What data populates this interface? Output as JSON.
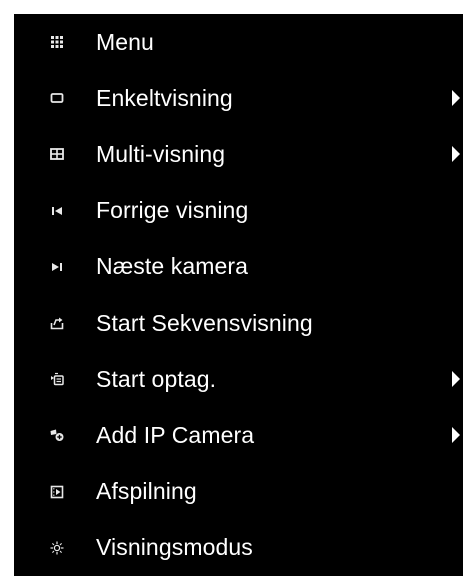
{
  "menu": {
    "items": [
      {
        "label": "Menu",
        "icon": "grid-icon",
        "has_submenu": false
      },
      {
        "label": "Enkeltvisning",
        "icon": "single-view-icon",
        "has_submenu": true
      },
      {
        "label": "Multi-visning",
        "icon": "multi-view-icon",
        "has_submenu": true
      },
      {
        "label": "Forrige visning",
        "icon": "previous-icon",
        "has_submenu": false
      },
      {
        "label": "Næste kamera",
        "icon": "next-icon",
        "has_submenu": false
      },
      {
        "label": "Start Sekvensvisning",
        "icon": "sequence-icon",
        "has_submenu": false
      },
      {
        "label": "Start optag.",
        "icon": "record-icon",
        "has_submenu": true
      },
      {
        "label": "Add IP Camera",
        "icon": "add-ip-camera-icon",
        "has_submenu": true
      },
      {
        "label": "Afspilning",
        "icon": "playback-icon",
        "has_submenu": false
      },
      {
        "label": "Visningsmodus",
        "icon": "view-mode-icon",
        "has_submenu": false
      }
    ]
  },
  "colors": {
    "background": "#000000",
    "text": "#ffffff",
    "icon": "#e8e8e8"
  }
}
